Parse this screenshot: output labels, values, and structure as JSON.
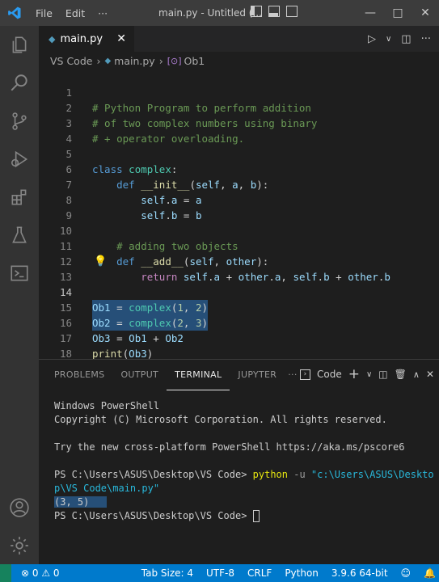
{
  "titlebar": {
    "menu": [
      "File",
      "Edit",
      "···"
    ],
    "title": "main.py - Untitled (...",
    "controls": [
      "minimize",
      "maximize",
      "close"
    ]
  },
  "tabs": [
    {
      "label": "main.py",
      "close": "✕"
    }
  ],
  "breadcrumb": [
    "VS Code",
    "main.py",
    "Ob1"
  ],
  "editor": {
    "active_line": 14,
    "lines": [
      {
        "n": "1",
        "text": "# Python Program to perform addition"
      },
      {
        "n": "2",
        "text": "# of two complex numbers using binary"
      },
      {
        "n": "3",
        "text": "# + operator overloading."
      },
      {
        "n": "4",
        "text": ""
      },
      {
        "n": "5",
        "text": "class complex:"
      },
      {
        "n": "6",
        "text": "    def __init__(self, a, b):"
      },
      {
        "n": "7",
        "text": "        self.a = a"
      },
      {
        "n": "8",
        "text": "        self.b = b"
      },
      {
        "n": "9",
        "text": ""
      },
      {
        "n": "10",
        "text": "    # adding two objects"
      },
      {
        "n": "11",
        "text": "    def __add__(self, other):"
      },
      {
        "n": "12",
        "text": "        return self.a + other.a, self.b + other.b"
      },
      {
        "n": "13",
        "text": ""
      },
      {
        "n": "14",
        "text": "Ob1 = complex(1, 2)"
      },
      {
        "n": "15",
        "text": "Ob2 = complex(2, 3)"
      },
      {
        "n": "16",
        "text": "Ob3 = Ob1 + Ob2"
      },
      {
        "n": "17",
        "text": "print(Ob3)"
      },
      {
        "n": "18",
        "text": ""
      }
    ]
  },
  "panel": {
    "tabs": [
      "PROBLEMS",
      "OUTPUT",
      "TERMINAL",
      "JUPYTER"
    ],
    "active_tab": "TERMINAL",
    "more": "···",
    "terminal_name": "Code",
    "add": "+",
    "dropdown": "∨",
    "close": "✕"
  },
  "terminal": {
    "l1": "Windows PowerShell",
    "l2": "Copyright (C) Microsoft Corporation. All rights reserved.",
    "l3": "Try the new cross-platform PowerShell https://aka.ms/pscore6",
    "prompt1": "PS C:\\Users\\ASUS\\Desktop\\VS Code> ",
    "cmd": "python",
    "flag": " -u ",
    "path1": "\"c:\\Users\\ASUS\\Deskto",
    "path2": "p\\VS Code\\main.py\"",
    "output": "(3, 5)",
    "prompt2": "PS C:\\Users\\ASUS\\Desktop\\VS Code> "
  },
  "statusbar": {
    "problems": "⊗ 0 ⚠ 0",
    "tab_size": "Tab Size: 4",
    "encoding": "UTF-8",
    "eol": "CRLF",
    "language": "Python",
    "interpreter": "3.9.6 64-bit"
  },
  "colors": {
    "accent": "#007acc",
    "titlebar": "#3c3c3c",
    "activitybar": "#333333",
    "editor_bg": "#1e1e1e",
    "selection": "#264f78"
  }
}
